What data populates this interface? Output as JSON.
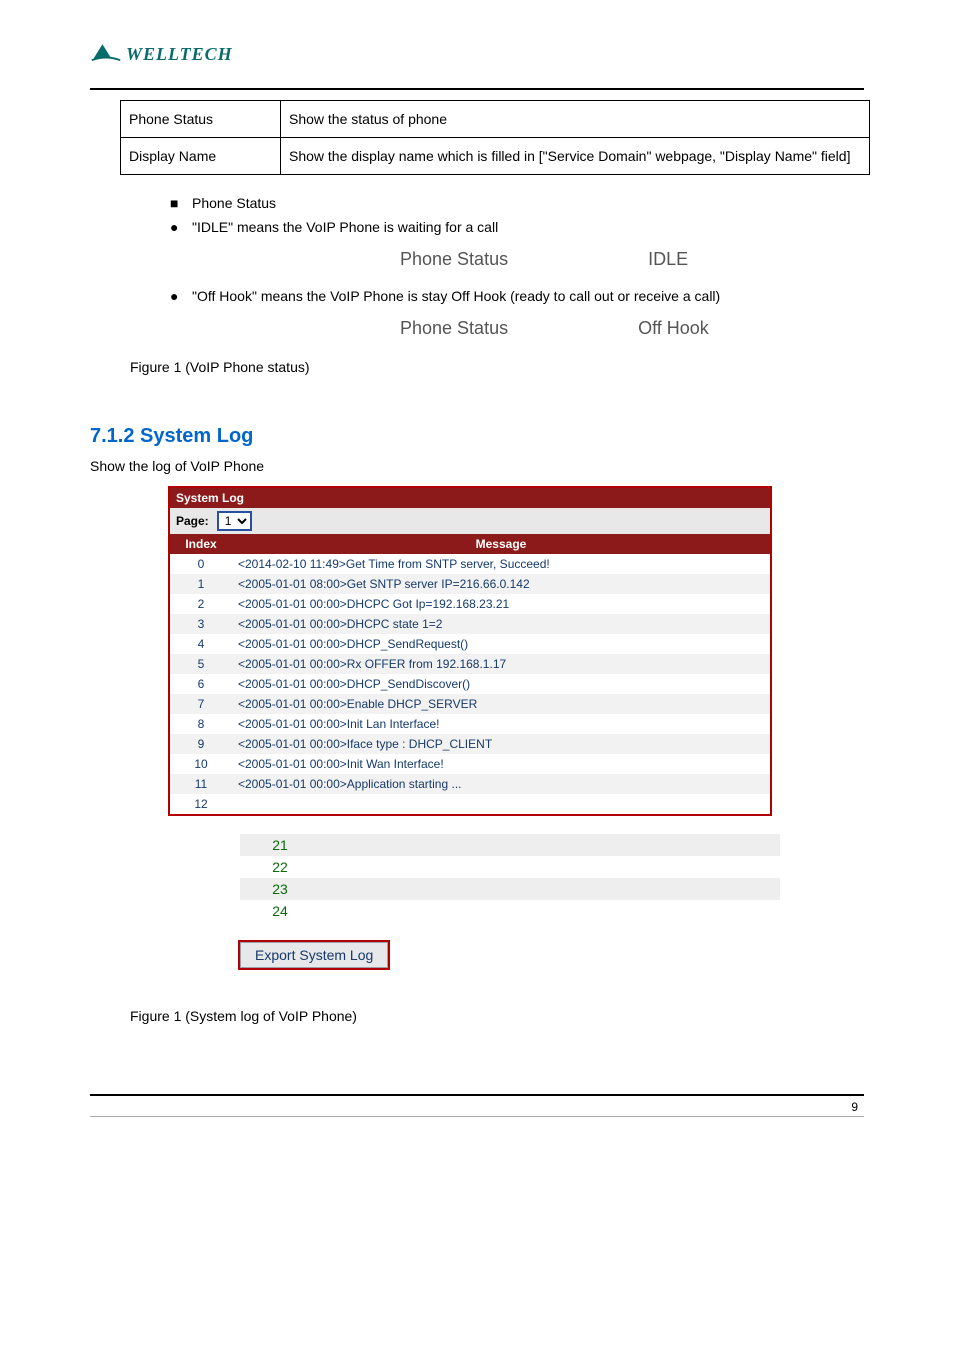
{
  "logo": {
    "text": "WELLTECH"
  },
  "top_table": {
    "rows": [
      [
        "Phone Status",
        "Show the status of phone"
      ],
      [
        "Display Name",
        "Show the display name which is filled in [\"Service Domain\" webpage, \"Display Name\" field]"
      ]
    ]
  },
  "phone_status": {
    "label": "Phone Status",
    "bullets": [
      {
        "text": "\"IDLE\" means the VoIP Phone is waiting for a call",
        "fig_label": "Phone Status",
        "fig_value": "IDLE"
      },
      {
        "text": "\"Off Hook\" means the VoIP Phone is stay Off Hook (ready to call out or receive a call)",
        "fig_label": "Phone Status",
        "fig_value": "Off Hook"
      }
    ],
    "caption": "Figure 1 (VoIP Phone status)"
  },
  "section": {
    "title": "7.1.2 System Log",
    "desc": "Show the log of VoIP Phone"
  },
  "syslog": {
    "title": "System Log",
    "page_label": "Page:",
    "page_value": "1",
    "headers": [
      "Index",
      "Message"
    ],
    "rows": [
      {
        "index": "0",
        "message": "<2014-02-10 11:49>Get Time from SNTP server, Succeed!"
      },
      {
        "index": "1",
        "message": "<2005-01-01 08:00>Get SNTP server IP=216.66.0.142"
      },
      {
        "index": "2",
        "message": "<2005-01-01 00:00>DHCPC Got Ip=192.168.23.21"
      },
      {
        "index": "3",
        "message": "<2005-01-01 00:00>DHCPC state 1=2"
      },
      {
        "index": "4",
        "message": "<2005-01-01 00:00>DHCP_SendRequest()"
      },
      {
        "index": "5",
        "message": "<2005-01-01 00:00>Rx OFFER from 192.168.1.17"
      },
      {
        "index": "6",
        "message": "<2005-01-01 00:00>DHCP_SendDiscover()"
      },
      {
        "index": "7",
        "message": "<2005-01-01 00:00>Enable DHCP_SERVER"
      },
      {
        "index": "8",
        "message": "<2005-01-01 00:00>Init Lan Interface!"
      },
      {
        "index": "9",
        "message": "<2005-01-01 00:00>Iface type : DHCP_CLIENT"
      },
      {
        "index": "10",
        "message": "<2005-01-01 00:00>Init Wan Interface!"
      },
      {
        "index": "11",
        "message": "<2005-01-01 00:00>Application starting ..."
      },
      {
        "index": "12",
        "message": ""
      }
    ]
  },
  "empty_rows": [
    "21",
    "22",
    "23",
    "24"
  ],
  "export_label": "Export System Log",
  "caption2": "Figure 1 (System log of VoIP Phone)",
  "footer": {
    "left": "",
    "right": "9"
  }
}
